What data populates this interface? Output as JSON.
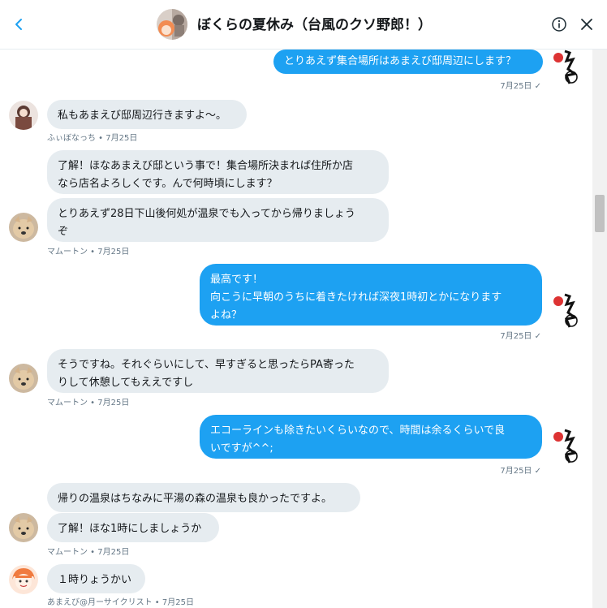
{
  "header": {
    "title": "ぼくらの夏休み（台風のクソ野郎！）",
    "back_icon": "chevron-left-icon",
    "info_icon": "info-icon",
    "close_icon": "close-icon"
  },
  "colors": {
    "outgoing_bubble": "#1da1f2",
    "incoming_bubble": "#e6ecf0",
    "meta_text": "#657786"
  },
  "messages": [
    {
      "text": "とりあえず集合場所はあまえび邸周辺にします？",
      "meta": "7月25日 ✓"
    },
    {
      "text": "私もあまえび邸周辺行きますよ〜。",
      "meta": "ふぃぼなっち • 7月25日"
    },
    {
      "text": "了解！ほなあまえび邸という事で！集合場所決まれば住所か店\nなら店名よろしくです。んで何時頃にします？"
    },
    {
      "text": "とりあえず28日下山後何処が温泉でも入ってから帰りましょう\nぞ",
      "meta": "マムートン • 7月25日"
    },
    {
      "text": "最高です！\n向こうに早朝のうちに着きたければ深夜1時初とかになります\nよね？",
      "meta": "7月25日 ✓"
    },
    {
      "text": "そうですね。それぐらいにして、早すぎると思ったらPA寄った\nりして休憩してもええですし",
      "meta": "マムートン • 7月25日"
    },
    {
      "text": "エコーラインも除きたいくらいなので、時間は余るくらいで良\nいですが^^;",
      "meta": "7月25日 ✓"
    },
    {
      "text": "帰りの温泉はちなみに平湯の森の温泉も良かったですよ。"
    },
    {
      "text": "了解！ほな1時にしましょうか",
      "meta": "マムートン • 7月25日"
    },
    {
      "text": "１時りょうかい",
      "meta": "あまえび@月ーサイクリスト • 7月25日"
    }
  ]
}
